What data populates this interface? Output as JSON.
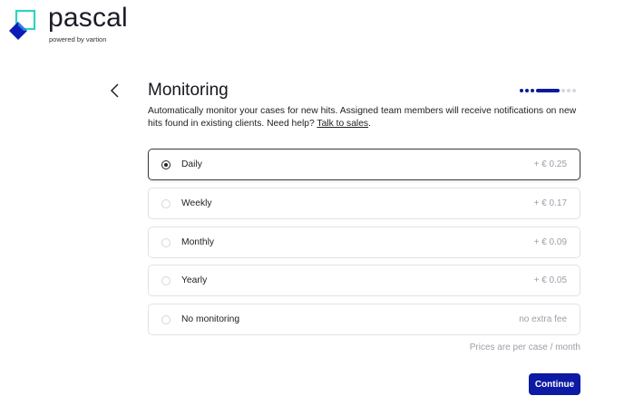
{
  "brand": {
    "name": "pascal",
    "tagline": "powered by vartion",
    "colors": {
      "blue": "#0b1db5",
      "light_blue": "#2b7de9",
      "teal": "#2fd3c2"
    }
  },
  "header": {
    "back_icon": "chevron-left-icon",
    "title": "Monitoring"
  },
  "progress": {
    "steps": [
      "done",
      "done",
      "done",
      "current",
      "todo",
      "todo",
      "todo"
    ],
    "colors": {
      "done": "#0b1a9c",
      "current": "#0b1a9c",
      "todo": "#d4d7dd"
    }
  },
  "description": {
    "text": "Automatically monitor your cases for new hits. Assigned team members will receive notifications on new hits found in existing clients. Need help? ",
    "link_label": "Talk to sales",
    "suffix": "."
  },
  "options": [
    {
      "label": "Daily",
      "price": "+ € 0.25",
      "selected": true
    },
    {
      "label": "Weekly",
      "price": "+ € 0.17",
      "selected": false
    },
    {
      "label": "Monthly",
      "price": "+ € 0.09",
      "selected": false
    },
    {
      "label": "Yearly",
      "price": "+ € 0.05",
      "selected": false
    },
    {
      "label": "No monitoring",
      "price": "no extra fee",
      "selected": false
    }
  ],
  "price_note": "Prices are per case / month",
  "continue_label": "Continue",
  "accent": "#0d1aa3"
}
